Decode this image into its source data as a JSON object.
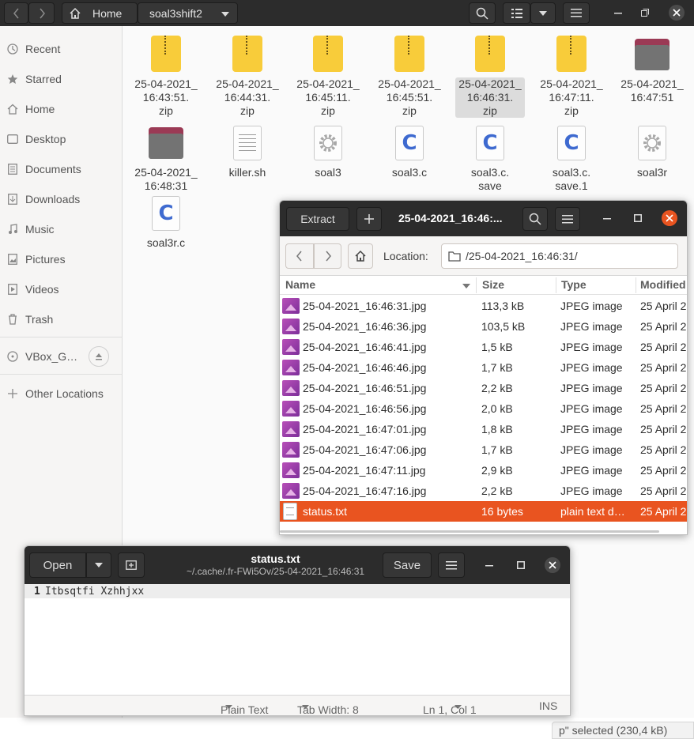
{
  "nautilus": {
    "header": {
      "home_label": "Home",
      "folder_label": "soal3shift2"
    },
    "sidebar": [
      {
        "label": "Recent",
        "icon": "clock-icon"
      },
      {
        "label": "Starred",
        "icon": "star-icon"
      },
      {
        "label": "Home",
        "icon": "home-icon"
      },
      {
        "label": "Desktop",
        "icon": "desktop-icon"
      },
      {
        "label": "Documents",
        "icon": "document-icon"
      },
      {
        "label": "Downloads",
        "icon": "download-icon"
      },
      {
        "label": "Music",
        "icon": "music-icon"
      },
      {
        "label": "Pictures",
        "icon": "picture-icon"
      },
      {
        "label": "Videos",
        "icon": "video-icon"
      },
      {
        "label": "Trash",
        "icon": "trash-icon"
      },
      {
        "label": "VBox_G…",
        "icon": "disc-icon"
      },
      {
        "label": "Other Locations",
        "icon": "plus-icon"
      }
    ],
    "files": [
      {
        "label": "25-04-2021_\n16:43:51.\nzip",
        "type": "zip"
      },
      {
        "label": "25-04-2021_\n16:44:31.\nzip",
        "type": "zip"
      },
      {
        "label": "25-04-2021_\n16:45:11.\nzip",
        "type": "zip"
      },
      {
        "label": "25-04-2021_\n16:45:51.\nzip",
        "type": "zip"
      },
      {
        "label": "25-04-2021_\n16:46:31.\nzip",
        "type": "zip",
        "selected": true
      },
      {
        "label": "25-04-2021_\n16:47:11.\nzip",
        "type": "zip"
      },
      {
        "label": "25-04-2021_\n16:47:51",
        "type": "folder"
      },
      {
        "label": "25-04-2021_\n16:48:31",
        "type": "folder"
      },
      {
        "label": "killer.sh",
        "type": "text"
      },
      {
        "label": "soal3",
        "type": "exec"
      },
      {
        "label": "soal3.c",
        "type": "c"
      },
      {
        "label": "soal3.c.\nsave",
        "type": "c"
      },
      {
        "label": "soal3.c.\nsave.1",
        "type": "c"
      },
      {
        "label": "soal3r",
        "type": "exec"
      },
      {
        "label": "soal3r.c",
        "type": "c"
      }
    ],
    "status": "p\" selected (230,4 kB)"
  },
  "roller": {
    "extract_label": "Extract",
    "title": "25-04-2021_16:46:...",
    "location_label": "Location:",
    "location_value": "/25-04-2021_16:46:31/",
    "columns": {
      "name": "Name",
      "size": "Size",
      "type": "Type",
      "modified": "Modified"
    },
    "rows": [
      {
        "name": "25-04-2021_16:46:31.jpg",
        "size": "113,3 kB",
        "type": "JPEG image",
        "modified": "25 April 2"
      },
      {
        "name": "25-04-2021_16:46:36.jpg",
        "size": "103,5 kB",
        "type": "JPEG image",
        "modified": "25 April 2"
      },
      {
        "name": "25-04-2021_16:46:41.jpg",
        "size": "1,5 kB",
        "type": "JPEG image",
        "modified": "25 April 2"
      },
      {
        "name": "25-04-2021_16:46:46.jpg",
        "size": "1,7 kB",
        "type": "JPEG image",
        "modified": "25 April 2"
      },
      {
        "name": "25-04-2021_16:46:51.jpg",
        "size": "2,2 kB",
        "type": "JPEG image",
        "modified": "25 April 2"
      },
      {
        "name": "25-04-2021_16:46:56.jpg",
        "size": "2,0 kB",
        "type": "JPEG image",
        "modified": "25 April 2"
      },
      {
        "name": "25-04-2021_16:47:01.jpg",
        "size": "1,8 kB",
        "type": "JPEG image",
        "modified": "25 April 2"
      },
      {
        "name": "25-04-2021_16:47:06.jpg",
        "size": "1,7 kB",
        "type": "JPEG image",
        "modified": "25 April 2"
      },
      {
        "name": "25-04-2021_16:47:11.jpg",
        "size": "2,9 kB",
        "type": "JPEG image",
        "modified": "25 April 2"
      },
      {
        "name": "25-04-2021_16:47:16.jpg",
        "size": "2,2 kB",
        "type": "JPEG image",
        "modified": "25 April 2"
      },
      {
        "name": "status.txt",
        "size": "16 bytes",
        "type": "plain text d…",
        "modified": "25 April 2",
        "selected": true
      }
    ],
    "selection_color": "#e95420"
  },
  "gedit": {
    "open_label": "Open",
    "save_label": "Save",
    "title": "status.txt",
    "subtitle": "~/.cache/.fr-FWi5Ov/25-04-2021_16:46:31",
    "line_number": "1",
    "content": "Itbsqtfi Xzhhjxx",
    "status": {
      "syntax": "Plain Text",
      "tab_width": "Tab Width: 8",
      "cursor": "Ln 1, Col 1",
      "mode": "INS"
    }
  }
}
